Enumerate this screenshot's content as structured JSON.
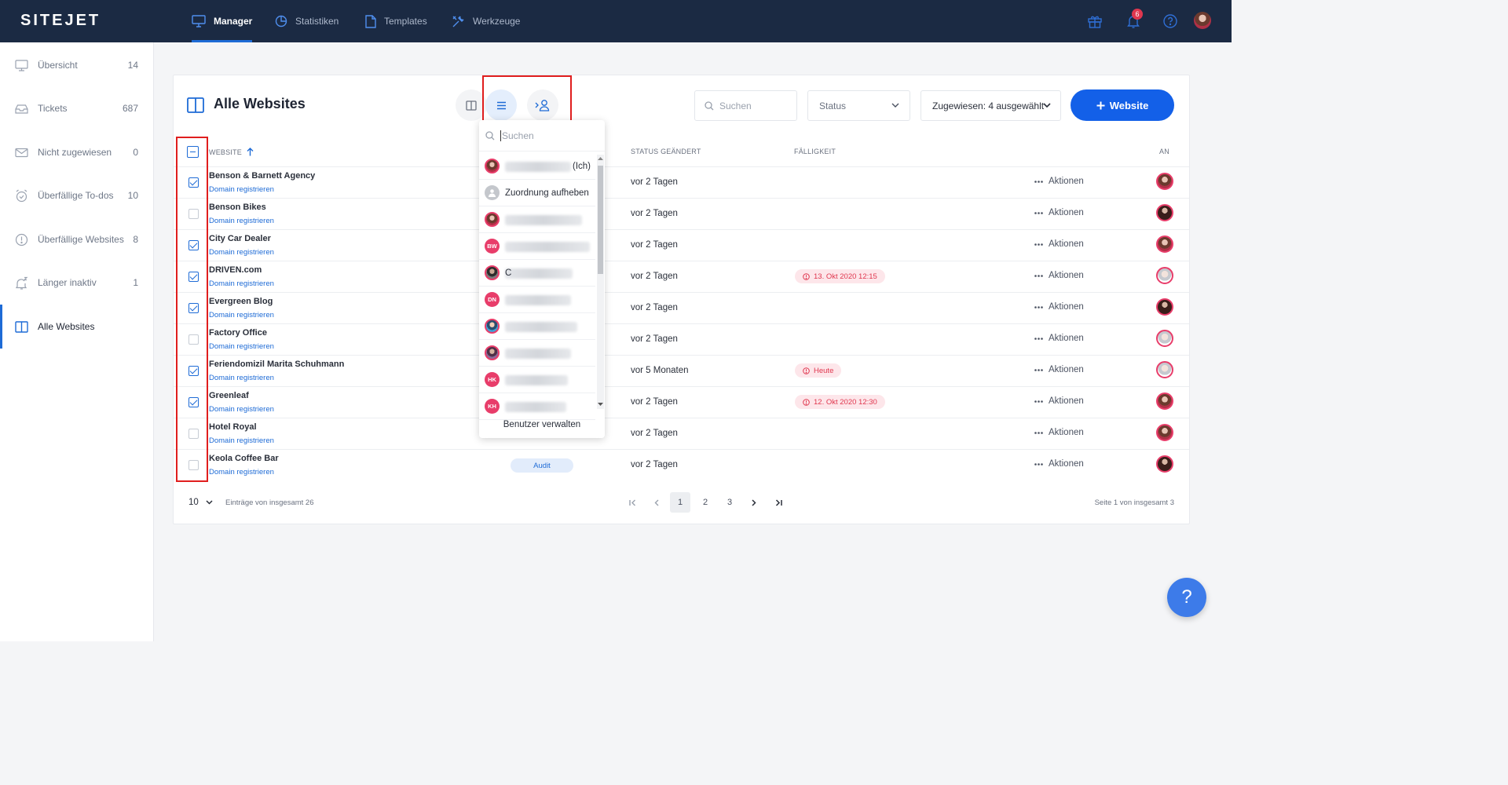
{
  "app": {
    "logo": "SITEJET"
  },
  "topnav": [
    {
      "label": "Manager",
      "icon": "monitor-icon"
    },
    {
      "label": "Statistiken",
      "icon": "pie-chart-icon"
    },
    {
      "label": "Templates",
      "icon": "document-icon"
    },
    {
      "label": "Werkzeuge",
      "icon": "tools-icon"
    }
  ],
  "topbar_right": {
    "notification_count": "6"
  },
  "sidebar": [
    {
      "label": "Übersicht",
      "count": "14",
      "icon": "monitor-icon"
    },
    {
      "label": "Tickets",
      "count": "687",
      "icon": "inbox-icon"
    },
    {
      "label": "Nicht zugewiesen",
      "count": "0",
      "icon": "envelope-icon"
    },
    {
      "label": "Überfällige To-dos",
      "count": "10",
      "icon": "alarm-clock-icon"
    },
    {
      "label": "Überfällige Websites",
      "count": "8",
      "icon": "alert-circle-icon"
    },
    {
      "label": "Länger inaktiv",
      "count": "1",
      "icon": "sleeping-bell-icon"
    },
    {
      "label": "Alle Websites",
      "count": "",
      "icon": "columns-icon"
    }
  ],
  "page": {
    "title": "Alle Websites"
  },
  "toolbar": {
    "search_placeholder": "Suchen",
    "status_label": "Status",
    "assigned_label": "Zugewiesen: 4 ausgewählt",
    "add_website_label": "Website"
  },
  "table": {
    "headers": {
      "website": "WEBSITE",
      "status_changed": "STATUS GEÄNDERT",
      "due": "FÄLLIGKEIT",
      "assigned": "AN"
    },
    "domain_link_label": "Domain registrieren",
    "actions_label": "Aktionen",
    "rows": [
      {
        "name": "Benson & Barnett Agency",
        "checked": true,
        "status_changed": "vor 2 Tagen",
        "due": "",
        "badge": ""
      },
      {
        "name": "Benson Bikes",
        "checked": false,
        "status_changed": "vor 2 Tagen",
        "due": "",
        "badge": ""
      },
      {
        "name": "City Car Dealer",
        "checked": true,
        "status_changed": "vor 2 Tagen",
        "due": "",
        "badge": ""
      },
      {
        "name": "DRIVEN.com",
        "checked": true,
        "status_changed": "vor 2 Tagen",
        "due": "13. Okt 2020 12:15",
        "badge": ""
      },
      {
        "name": "Evergreen Blog",
        "checked": true,
        "status_changed": "vor 2 Tagen",
        "due": "",
        "badge": ""
      },
      {
        "name": "Factory Office",
        "checked": false,
        "status_changed": "vor 2 Tagen",
        "due": "",
        "badge": ""
      },
      {
        "name": "Feriendomizil Marita Schuhmann",
        "checked": true,
        "status_changed": "vor 5 Monaten",
        "due": "Heute",
        "badge": ""
      },
      {
        "name": "Greenleaf",
        "checked": true,
        "status_changed": "vor 2 Tagen",
        "due": "12. Okt 2020 12:30",
        "badge": ""
      },
      {
        "name": "Hotel Royal",
        "checked": false,
        "status_changed": "vor 2 Tagen",
        "due": "",
        "badge": ""
      },
      {
        "name": "Keola Coffee Bar",
        "checked": false,
        "status_changed": "vor 2 Tagen",
        "due": "",
        "badge": "Audit"
      }
    ]
  },
  "assign_dropdown": {
    "search_placeholder": "Suchen",
    "items": [
      {
        "initials": "",
        "label": "(Ich)",
        "kind": "photo"
      },
      {
        "initials": "",
        "label": "Zuordnung aufheben",
        "kind": "unassign"
      },
      {
        "initials": "",
        "label": "",
        "kind": "photo"
      },
      {
        "initials": "BW",
        "label": "",
        "kind": "initials"
      },
      {
        "initials": "",
        "label": "C",
        "kind": "photo"
      },
      {
        "initials": "DN",
        "label": "",
        "kind": "initials"
      },
      {
        "initials": "",
        "label": "",
        "kind": "photo"
      },
      {
        "initials": "",
        "label": "",
        "kind": "photo"
      },
      {
        "initials": "HK",
        "label": "",
        "kind": "initials"
      },
      {
        "initials": "KH",
        "label": "",
        "kind": "initials"
      }
    ],
    "manage_users_label": "Benutzer verwalten"
  },
  "footer": {
    "page_size": "10",
    "total_text": "Einträge von insgesamt 26",
    "pages": [
      "1",
      "2",
      "3"
    ],
    "current_page": "1",
    "page_info": "Seite 1 von insgesamt 3"
  },
  "help_fab_label": "?",
  "colors": {
    "brand_dark": "#1b2a43",
    "primary": "#1360e8",
    "accent": "#1e6bd6",
    "danger": "#e0374f",
    "highlight_box": "#e01e1e"
  }
}
